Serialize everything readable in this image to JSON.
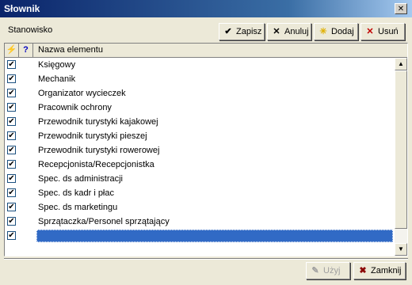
{
  "window": {
    "title": "Słownik",
    "close_glyph": "✕"
  },
  "header": {
    "label": "Stanowisko"
  },
  "toolbar": {
    "save_label": "Zapisz",
    "save_icon": "✔",
    "cancel_label": "Anuluj",
    "cancel_icon": "✕",
    "add_label": "Dodaj",
    "add_icon": "✳",
    "delete_label": "Usuń",
    "delete_icon": "✕"
  },
  "grid": {
    "col_flag": "⚡",
    "col_help": "?",
    "col_name": "Nazwa elementu",
    "rows": [
      {
        "label": "Księgowy",
        "checked": "✔"
      },
      {
        "label": "Mechanik",
        "checked": "✔"
      },
      {
        "label": "Organizator wycieczek",
        "checked": "✔"
      },
      {
        "label": "Pracownik ochrony",
        "checked": "✔"
      },
      {
        "label": "Przewodnik turystyki kajakowej",
        "checked": "✔"
      },
      {
        "label": "Przewodnik turystyki pieszej",
        "checked": "✔"
      },
      {
        "label": "Przewodnik turystyki rowerowej",
        "checked": "✔"
      },
      {
        "label": "Recepcjonista/Recepcjonistka",
        "checked": "✔"
      },
      {
        "label": "Spec. ds administracji",
        "checked": "✔"
      },
      {
        "label": "Spec. ds kadr i płac",
        "checked": "✔"
      },
      {
        "label": "Spec. ds marketingu",
        "checked": "✔"
      },
      {
        "label": "Sprzątaczka/Personel sprzątający",
        "checked": "✔"
      },
      {
        "label": "",
        "checked": "✔"
      }
    ]
  },
  "footer": {
    "use_label": "Użyj",
    "use_icon": "✎",
    "close_label": "Zamknij",
    "close_icon": "✖"
  },
  "colors": {
    "title_start": "#0a246a",
    "title_end": "#a6caf0",
    "selection": "#316ac5"
  }
}
